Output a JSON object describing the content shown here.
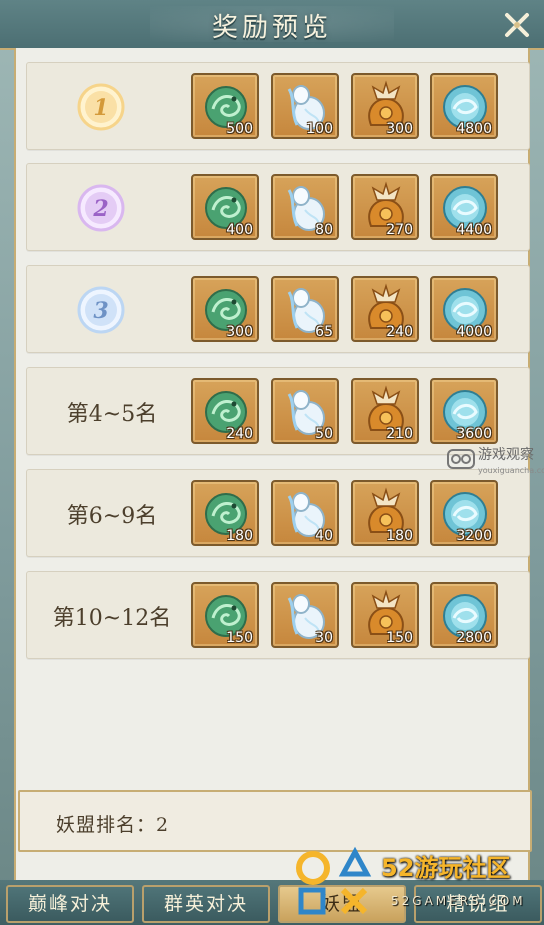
{
  "header": {
    "title": "奖励预览"
  },
  "rows": [
    {
      "rank_icon": "rank-1-medal-icon",
      "rank_label": "",
      "items": [
        {
          "icon": "jade-dragon-icon",
          "qty": "500"
        },
        {
          "icon": "water-gourd-icon",
          "qty": "100"
        },
        {
          "icon": "treasure-bag-icon",
          "qty": "300"
        },
        {
          "icon": "spirit-orb-icon",
          "qty": "4800"
        }
      ]
    },
    {
      "rank_icon": "rank-2-medal-icon",
      "rank_label": "",
      "items": [
        {
          "icon": "jade-dragon-icon",
          "qty": "400"
        },
        {
          "icon": "water-gourd-icon",
          "qty": "80"
        },
        {
          "icon": "treasure-bag-icon",
          "qty": "270"
        },
        {
          "icon": "spirit-orb-icon",
          "qty": "4400"
        }
      ]
    },
    {
      "rank_icon": "rank-3-medal-icon",
      "rank_label": "",
      "items": [
        {
          "icon": "jade-dragon-icon",
          "qty": "300"
        },
        {
          "icon": "water-gourd-icon",
          "qty": "65"
        },
        {
          "icon": "treasure-bag-icon",
          "qty": "240"
        },
        {
          "icon": "spirit-orb-icon",
          "qty": "4000"
        }
      ]
    },
    {
      "rank_icon": "",
      "rank_label": "第4~5名",
      "items": [
        {
          "icon": "jade-dragon-icon",
          "qty": "240"
        },
        {
          "icon": "water-gourd-icon",
          "qty": "50"
        },
        {
          "icon": "treasure-bag-icon",
          "qty": "210"
        },
        {
          "icon": "spirit-orb-icon",
          "qty": "3600"
        }
      ]
    },
    {
      "rank_icon": "",
      "rank_label": "第6~9名",
      "items": [
        {
          "icon": "jade-dragon-icon",
          "qty": "180"
        },
        {
          "icon": "water-gourd-icon",
          "qty": "40"
        },
        {
          "icon": "treasure-bag-icon",
          "qty": "180"
        },
        {
          "icon": "spirit-orb-icon",
          "qty": "3200"
        }
      ]
    },
    {
      "rank_icon": "",
      "rank_label": "第10~12名",
      "items": [
        {
          "icon": "jade-dragon-icon",
          "qty": "150"
        },
        {
          "icon": "water-gourd-icon",
          "qty": "30"
        },
        {
          "icon": "treasure-bag-icon",
          "qty": "150"
        },
        {
          "icon": "spirit-orb-icon",
          "qty": "2800"
        }
      ]
    }
  ],
  "guild_rank": {
    "label": "妖盟排名：2"
  },
  "tabs": [
    {
      "label": "巅峰对决"
    },
    {
      "label": "群英对决"
    },
    {
      "label": "妖盟"
    },
    {
      "label": "精锐组"
    }
  ],
  "watermarks": {
    "brand_52": "52游玩社区",
    "brand_52_sub": "52GAMERS.COM",
    "youxi": "游戏观察",
    "youxi_sub": "youxiguancha.com"
  }
}
